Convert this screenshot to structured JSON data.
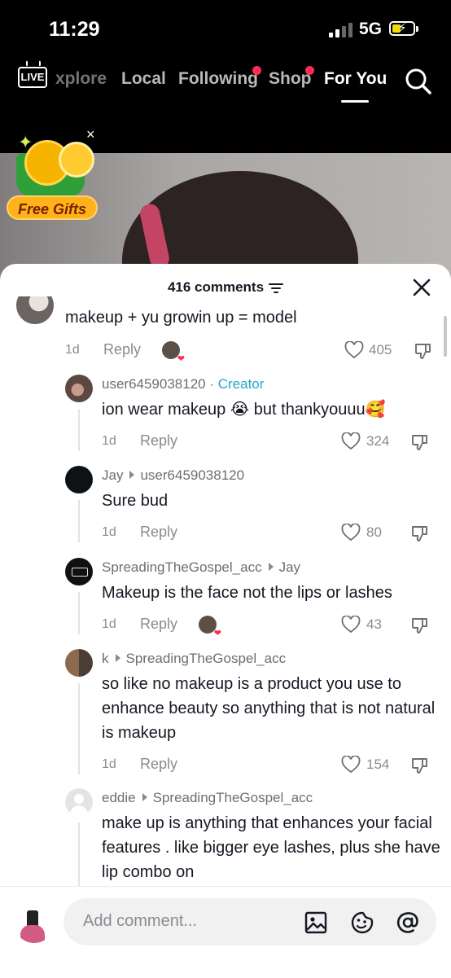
{
  "status_bar": {
    "time": "11:29",
    "network": "5G"
  },
  "top_nav": {
    "live_label": "LIVE",
    "tabs": [
      {
        "label": "xplore",
        "dot": false,
        "active": false
      },
      {
        "label": "Local",
        "dot": false,
        "active": false
      },
      {
        "label": "Following",
        "dot": true,
        "active": false
      },
      {
        "label": "Shop",
        "dot": true,
        "active": false
      },
      {
        "label": "For You",
        "dot": false,
        "active": true
      }
    ]
  },
  "gift_widget": {
    "label": "Free Gifts",
    "close": "×"
  },
  "comments_panel": {
    "count_label": "416 comments",
    "comments": [
      {
        "text": "makeup + yu growin up = model",
        "age": "1d",
        "reply": "Reply",
        "likes": "405"
      },
      {
        "username": "user6459038120",
        "creator_tag": "Creator",
        "text": "ion wear makeup 😭 but thankyouuu🥰",
        "age": "1d",
        "reply": "Reply",
        "likes": "324"
      },
      {
        "username": "Jay",
        "reply_to": "user6459038120",
        "text": "Sure bud",
        "age": "1d",
        "reply": "Reply",
        "likes": "80"
      },
      {
        "username": "SpreadingTheGospel_acc",
        "reply_to": "Jay",
        "text": "Makeup is the face not the lips or lashes",
        "age": "1d",
        "reply": "Reply",
        "likes": "43"
      },
      {
        "username": "k",
        "reply_to": "SpreadingTheGospel_acc",
        "text": "so like no makeup is a product you use to enhance beauty so anything that is not natural is makeup",
        "age": "1d",
        "reply": "Reply",
        "likes": "154"
      },
      {
        "username": "eddie",
        "reply_to": "SpreadingTheGospel_acc",
        "text": "make up is anything that enhances your facial features . like bigger eye lashes, plus she have lip combo on"
      }
    ]
  },
  "composer": {
    "placeholder": "Add comment..."
  },
  "colors": {
    "accent": "#fe2c55",
    "creator": "#1fa8c9",
    "muted": "#8a8b91"
  }
}
